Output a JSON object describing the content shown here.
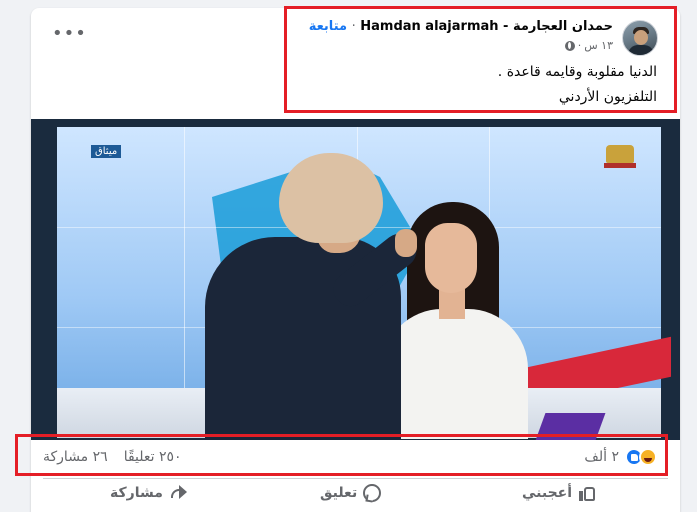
{
  "post": {
    "author_name": "حمدان العجارمة - Hamdan alajarmah",
    "separator": "·",
    "follow_label": "متابعة",
    "timestamp": "١٣ س",
    "audience_dot": "·",
    "audience_icon": "globe-icon",
    "text_line_1": "الدنيا مقلوبة وقايمه قاعدة .",
    "text_line_2": "التلفزيون الأردني"
  },
  "media": {
    "image_description_icon": "tv-studio-photo",
    "channel_logo_text": "ميثاق"
  },
  "engagement": {
    "reactions_count": "٢ ألف",
    "reaction_icons": [
      "like-icon",
      "haha-icon"
    ],
    "comments_label": "٢٥٠ تعليقًا",
    "shares_label": "٢٦ مشاركة"
  },
  "actions": {
    "like_label": "أعجبني",
    "comment_label": "تعليق",
    "share_label": "مشاركة"
  },
  "menu": {
    "more_label": "•••"
  },
  "colors": {
    "accent": "#1877f2",
    "highlight": "#e41e26",
    "muted": "#65676b"
  }
}
